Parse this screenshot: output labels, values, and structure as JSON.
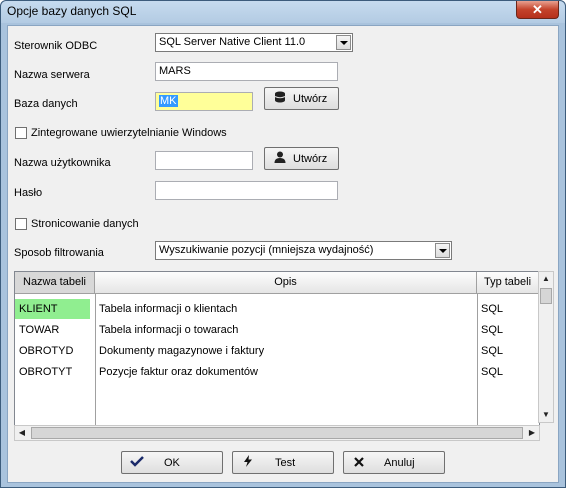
{
  "window": {
    "title": "Opcje bazy danych SQL",
    "close_symbol": "✕"
  },
  "form": {
    "odbc_label": "Sterownik ODBC",
    "odbc_value": "SQL Server Native Client 11.0",
    "server_label": "Nazwa serwera",
    "server_value": "MARS",
    "db_label": "Baza danych",
    "db_value": "MK",
    "db_create_label": "Utwórz",
    "windows_auth_label": "Zintegrowane uwierzytelnianie Windows",
    "user_label": "Nazwa użytkownika",
    "user_value": "",
    "user_create_label": "Utwórz",
    "password_label": "Hasło",
    "password_value": "",
    "paging_label": "Stronicowanie danych",
    "filter_label": "Sposob filtrowania",
    "filter_value": "Wyszukiwanie pozycji (mniejsza wydajność)"
  },
  "table": {
    "columns": [
      "Nazwa tabeli",
      "Opis",
      "Typ tabeli"
    ],
    "rows": [
      [
        "KLIENT",
        "Tabela informacji o klientach",
        "SQL"
      ],
      [
        "TOWAR",
        "Tabela informacji o towarach",
        "SQL"
      ],
      [
        "OBROTYD",
        "Dokumenty magazynowe i faktury",
        "SQL"
      ],
      [
        "OBROTYT",
        "Pozycje faktur oraz dokumentów",
        "SQL"
      ]
    ]
  },
  "buttons": {
    "ok": "OK",
    "test": "Test",
    "cancel": "Anuluj"
  },
  "icons": {
    "database": "database-icon",
    "user": "user-icon",
    "ok": "ok-icon",
    "test": "lightning-icon",
    "cancel": "close-icon"
  },
  "colors": {
    "selected_field": "#ffff99",
    "selected_row": "#90ee90",
    "close": "#c4432b"
  }
}
